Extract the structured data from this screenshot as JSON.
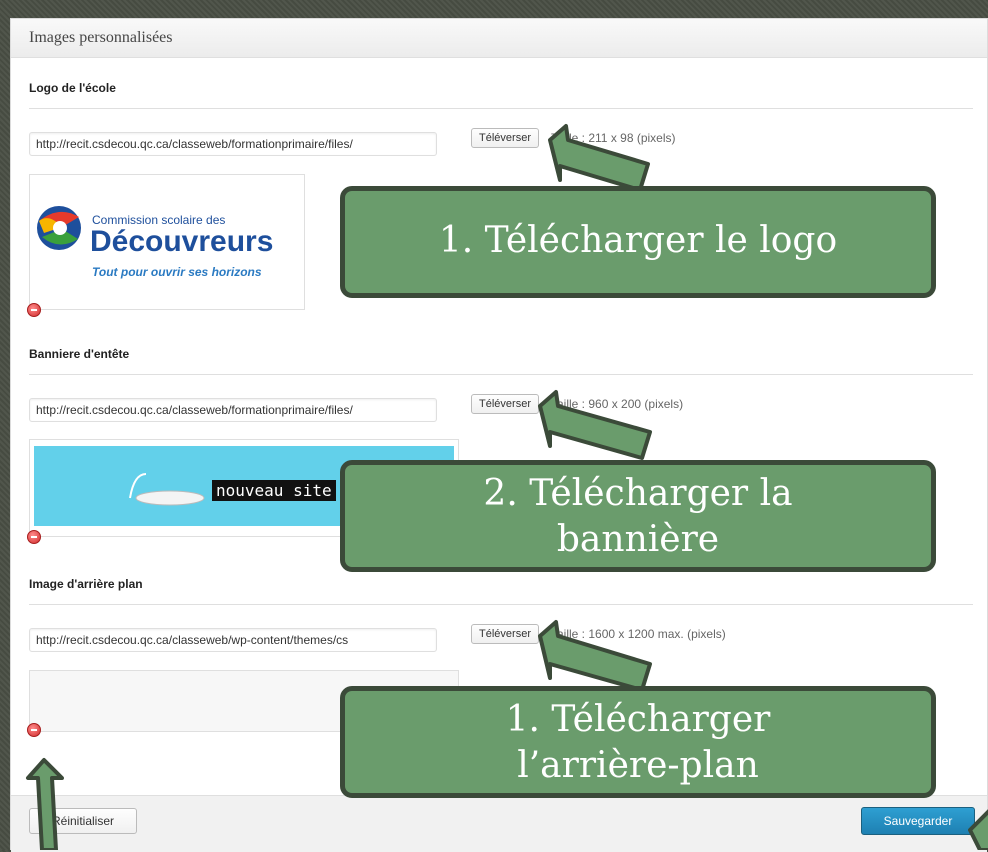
{
  "panel": {
    "title": "Images personnalisées"
  },
  "logo_section": {
    "title": "Logo de l'école",
    "url": "http://recit.csdecou.qc.ca/classeweb/formationprimaire/files/",
    "upload_label": "Téléverser",
    "size_text": "Taille : 211 x 98 (pixels)",
    "logo_line1": "Commission scolaire des",
    "logo_line2": "Découvreurs",
    "logo_line3": "Tout pour ouvrir ses horizons"
  },
  "banner_section": {
    "title": "Banniere d'entête",
    "url": "http://recit.csdecou.qc.ca/classeweb/formationprimaire/files/",
    "upload_label": "Téléverser",
    "size_text": "Taille : 960 x 200 (pixels)",
    "banner_text": "nouveau site"
  },
  "background_section": {
    "title": "Image d'arrière plan",
    "url": "http://recit.csdecou.qc.ca/classeweb/wp-content/themes/cs",
    "upload_label": "Téléverser",
    "size_text": "Taille : 1600 x 1200 max. (pixels)"
  },
  "footer": {
    "reset_label": "Réinitialiser",
    "save_label": "Sauvegarder"
  },
  "callouts": {
    "logo": "1.  Télécharger le logo",
    "banner_line1": "2. Télécharger la",
    "banner_line2": "bannière",
    "background_line1": "1.  Télécharger",
    "background_line2": "l’arrière-plan"
  },
  "colors": {
    "callout_fill": "#6a9c6c",
    "callout_border": "#3b4a39",
    "save_button": "#2184b8",
    "remove_icon": "#d12c2c"
  }
}
